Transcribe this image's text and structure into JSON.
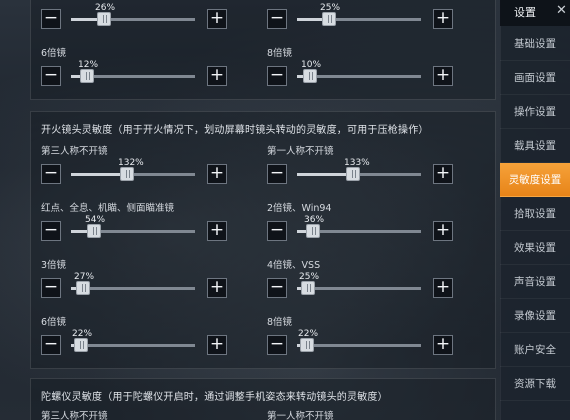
{
  "sidebar": {
    "title": "设置",
    "items": [
      {
        "label": "基础设置"
      },
      {
        "label": "画面设置"
      },
      {
        "label": "操作设置"
      },
      {
        "label": "载具设置"
      },
      {
        "label": "灵敏度设置"
      },
      {
        "label": "拾取设置"
      },
      {
        "label": "效果设置"
      },
      {
        "label": "声音设置"
      },
      {
        "label": "录像设置"
      },
      {
        "label": "账户安全"
      },
      {
        "label": "资源下载"
      }
    ]
  },
  "top": {
    "rows": [
      {
        "left": {
          "label": "",
          "value": "26%",
          "level": 0.26
        },
        "right": {
          "label": "",
          "value": "25%",
          "level": 0.25
        }
      },
      {
        "left": {
          "label": "6倍镜",
          "value": "12%",
          "level": 0.12
        },
        "right": {
          "label": "8倍镜",
          "value": "10%",
          "level": 0.1
        }
      }
    ]
  },
  "fire": {
    "title": "开火镜头灵敏度（用于开火情况下，划动屏幕时镜头转动的灵敏度，可用于压枪操作）",
    "rows": [
      {
        "left": {
          "label": "第三人称不开镜",
          "value": "132%",
          "level": 0.44
        },
        "right": {
          "label": "第一人称不开镜",
          "value": "133%",
          "level": 0.44
        }
      },
      {
        "left": {
          "label": "红点、全息、机瞄、侧面瞄准镜",
          "value": "54%",
          "level": 0.18
        },
        "right": {
          "label": "2倍镜、Win94",
          "value": "36%",
          "level": 0.12
        }
      },
      {
        "left": {
          "label": "3倍镜",
          "value": "27%",
          "level": 0.09
        },
        "right": {
          "label": "4倍镜、VSS",
          "value": "25%",
          "level": 0.08
        }
      },
      {
        "left": {
          "label": "6倍镜",
          "value": "22%",
          "level": 0.07
        },
        "right": {
          "label": "8倍镜",
          "value": "22%",
          "level": 0.07
        }
      }
    ]
  },
  "gyro": {
    "title": "陀螺仪灵敏度（用于陀螺仪开启时，通过调整手机姿态来转动镜头的灵敏度）",
    "first_row": {
      "left": "第三人称不开镜",
      "right": "第一人称不开镜"
    }
  },
  "controls": {
    "minus": "−",
    "plus": "+"
  }
}
